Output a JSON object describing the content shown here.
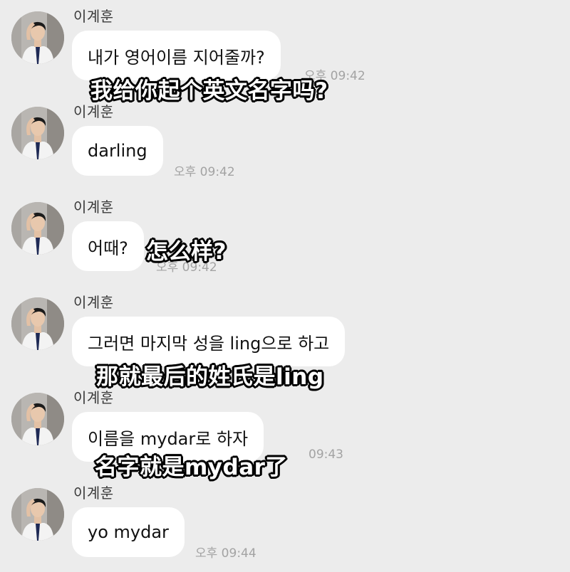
{
  "messages": [
    {
      "sender": "이계훈",
      "text": "내가 영어이름 지어줄까?",
      "time": "오후 09:42",
      "caption": "我给你起个英文名字吗?"
    },
    {
      "sender": "이계훈",
      "text": "darling",
      "time": "오후 09:42",
      "caption": ""
    },
    {
      "sender": "이계훈",
      "text": "어때?",
      "time": "오후 09:42",
      "caption": "怎么样?"
    },
    {
      "sender": "이계훈",
      "text": "그러면 마지막 성을 ling으로 하고",
      "time": "",
      "caption": "那就最后的姓氏是ling"
    },
    {
      "sender": "이계훈",
      "text": "이름을 mydar로 하자",
      "time": "09:43",
      "caption": "名字就是mydar了"
    },
    {
      "sender": "이계훈",
      "text": "yo mydar",
      "time": "오후 09:44",
      "caption": ""
    }
  ],
  "colors": {
    "background": "#ececec",
    "bubble": "#ffffff",
    "time_text": "#a3a3a3",
    "caption_fill": "#ffffff",
    "caption_outline": "#000000"
  },
  "icons": {
    "avatar": "profile-photo-avatar"
  }
}
